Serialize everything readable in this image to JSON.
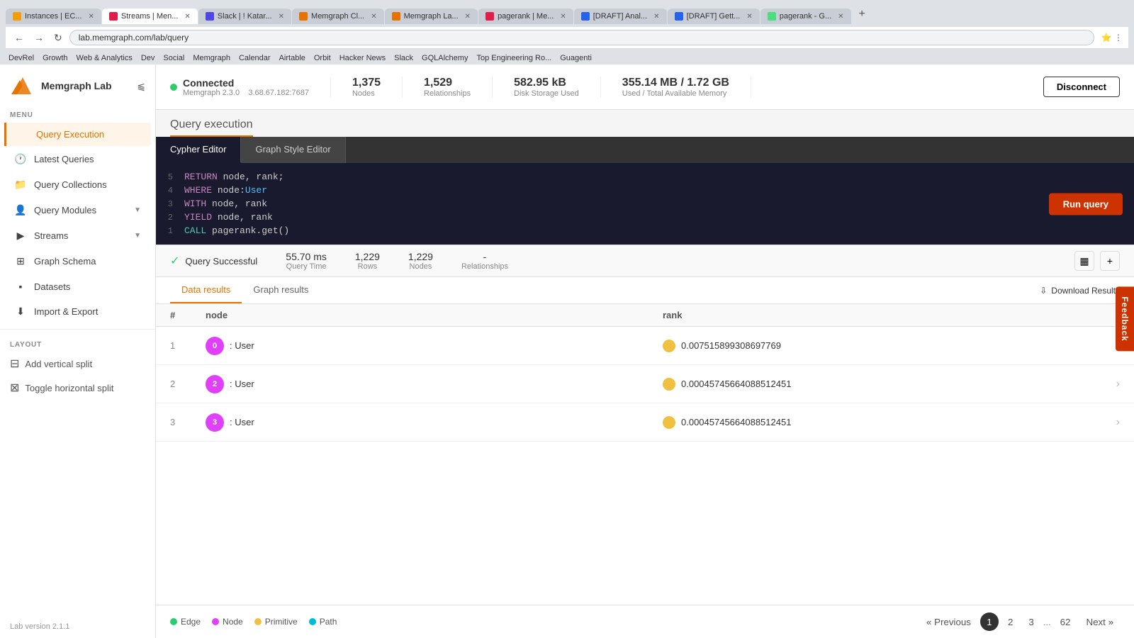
{
  "browser": {
    "tabs": [
      {
        "id": "t1",
        "title": "Instances | EC...",
        "color": "#f59e0b",
        "active": false
      },
      {
        "id": "t2",
        "title": "Streams | Men...",
        "color": "#e11d48",
        "active": true
      },
      {
        "id": "t3",
        "title": "Slack | ! Katar...",
        "color": "#4f46e5",
        "active": false
      },
      {
        "id": "t4",
        "title": "Memgraph Cl...",
        "color": "#e67300",
        "active": false
      },
      {
        "id": "t5",
        "title": "Memgraph La...",
        "color": "#e67300",
        "active": false
      },
      {
        "id": "t6",
        "title": "pagerank | Me...",
        "color": "#e11d48",
        "active": false
      },
      {
        "id": "t7",
        "title": "[DRAFT] Anal...",
        "color": "#2563eb",
        "active": false
      },
      {
        "id": "t8",
        "title": "[DRAFT] Gett...",
        "color": "#2563eb",
        "active": false
      },
      {
        "id": "t9",
        "title": "pagerank - G...",
        "color": "#4ade80",
        "active": false
      }
    ],
    "address": "lab.memgraph.com/lab/query",
    "bookmarks": [
      "DevRel",
      "Growth",
      "Web & Analytics",
      "Dev",
      "Social",
      "Memgraph",
      "Calendar",
      "Airtable",
      "Orbit",
      "Hacker News",
      "Slack",
      "GQLAlchemy",
      "Top Engineering Ro...",
      "Guagenti"
    ]
  },
  "header": {
    "logo_text": "Memgraph Lab",
    "connection": {
      "status": "Connected",
      "version": "Memgraph 2.3.0",
      "host": "3.68.67.182:7687"
    },
    "stats": [
      {
        "value": "1,375",
        "label": "Nodes"
      },
      {
        "value": "1,529",
        "label": "Relationships"
      },
      {
        "value": "582.95 kB",
        "label": "Disk Storage Used"
      },
      {
        "value": "355.14 MB / 1.72 GB",
        "label": "Used / Total Available Memory"
      }
    ],
    "disconnect_label": "Disconnect"
  },
  "sidebar": {
    "menu_label": "MENU",
    "layout_label": "LAYOUT",
    "items": [
      {
        "id": "query-execution",
        "label": "Query Execution",
        "icon": "</>",
        "active": true
      },
      {
        "id": "latest-queries",
        "label": "Latest Queries",
        "icon": "🕐",
        "active": false
      },
      {
        "id": "query-collections",
        "label": "Query Collections",
        "icon": "📁",
        "active": false
      },
      {
        "id": "query-modules",
        "label": "Query Modules",
        "icon": "👤",
        "active": false,
        "arrow": "▼"
      },
      {
        "id": "streams",
        "label": "Streams",
        "icon": "▶",
        "active": false,
        "arrow": "▼"
      },
      {
        "id": "graph-schema",
        "label": "Graph Schema",
        "icon": "⊞",
        "active": false
      },
      {
        "id": "datasets",
        "label": "Datasets",
        "icon": "▪",
        "active": false
      },
      {
        "id": "import-export",
        "label": "Import & Export",
        "icon": "⬇",
        "active": false
      }
    ],
    "layout_items": [
      {
        "id": "add-vertical-split",
        "label": "Add vertical split",
        "icon": "⊟"
      },
      {
        "id": "toggle-horizontal-split",
        "label": "Toggle horizontal split",
        "icon": "⊠"
      }
    ],
    "version": "Lab version 2.1.1"
  },
  "page": {
    "title": "Query execution"
  },
  "editor": {
    "tabs": [
      {
        "id": "cypher",
        "label": "Cypher Editor",
        "active": true
      },
      {
        "id": "style",
        "label": "Graph Style Editor",
        "active": false
      }
    ],
    "code_lines": [
      {
        "num": "1",
        "content": "CALL pagerank.get()",
        "tokens": [
          {
            "text": "CALL",
            "class": "kw-call"
          },
          {
            "text": " pagerank.get()",
            "class": ""
          }
        ]
      },
      {
        "num": "2",
        "content": "YIELD node, rank",
        "tokens": [
          {
            "text": "YIELD",
            "class": "kw-yield"
          },
          {
            "text": " node, rank",
            "class": ""
          }
        ]
      },
      {
        "num": "3",
        "content": "WITH node, rank",
        "tokens": [
          {
            "text": "WITH",
            "class": "kw-with"
          },
          {
            "text": " node, rank",
            "class": ""
          }
        ]
      },
      {
        "num": "4",
        "content": "WHERE node:User",
        "tokens": [
          {
            "text": "WHERE",
            "class": "kw-where"
          },
          {
            "text": " node:",
            "class": ""
          },
          {
            "text": "User",
            "class": "kw-label"
          }
        ]
      },
      {
        "num": "5",
        "content": "RETURN node, rank;",
        "tokens": [
          {
            "text": "RETURN",
            "class": "kw-return"
          },
          {
            "text": " node, rank;",
            "class": ""
          }
        ]
      }
    ],
    "run_button": "Run query"
  },
  "result": {
    "status": "Query Successful",
    "query_time": "55.70 ms",
    "query_time_label": "Query Time",
    "rows": "1,229",
    "rows_label": "Rows",
    "nodes": "1,229",
    "nodes_label": "Nodes",
    "relationships": "-",
    "relationships_label": "Relationships"
  },
  "data_tabs": [
    {
      "id": "data-results",
      "label": "Data results",
      "active": true
    },
    {
      "id": "graph-results",
      "label": "Graph results",
      "active": false
    }
  ],
  "download_label": "Download Results",
  "table": {
    "headers": [
      "#",
      "node",
      "rank"
    ],
    "rows": [
      {
        "num": "1",
        "node_id": "0",
        "node_label": ": User",
        "badge_color": "#e040fb",
        "rank_val": "0.007515899308697769"
      },
      {
        "num": "2",
        "node_id": "2",
        "node_label": ": User",
        "badge_color": "#e040fb",
        "rank_val": "0.00045745664088512451"
      },
      {
        "num": "3",
        "node_id": "3",
        "node_label": ": User",
        "badge_color": "#e040fb",
        "rank_val": "0.00045745664088512451"
      }
    ]
  },
  "legend": [
    {
      "label": "Edge",
      "color": "#2ecc71"
    },
    {
      "label": "Node",
      "color": "#e040fb"
    },
    {
      "label": "Primitive",
      "color": "#f0c040"
    },
    {
      "label": "Path",
      "color": "#00bcd4"
    }
  ],
  "pagination": {
    "prev_label": "« Previous",
    "next_label": "Next »",
    "pages": [
      "1",
      "2",
      "3",
      "...",
      "62"
    ],
    "active_page": "1"
  },
  "feedback_label": "Feedback"
}
